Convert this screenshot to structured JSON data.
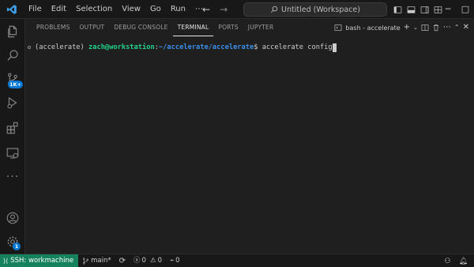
{
  "menu": [
    "File",
    "Edit",
    "Selection",
    "View",
    "Go",
    "Run"
  ],
  "command_center": {
    "text": "Untitled (Workspace)"
  },
  "activity_badges": {
    "source_control": "1K+",
    "accounts_settings": "1"
  },
  "panel": {
    "tabs": [
      "PROBLEMS",
      "OUTPUT",
      "DEBUG CONSOLE",
      "TERMINAL",
      "PORTS",
      "JUPYTER"
    ],
    "active_tab": "TERMINAL",
    "terminal_name": "bash - accelerate"
  },
  "terminal": {
    "env": "(accelerate)",
    "user_host": "zach@workstation",
    "sep": ":",
    "path": "~/accelerate/accelerate",
    "prompt": "$",
    "command": "accelerate config"
  },
  "status": {
    "remote": "SSH: workmachine",
    "branch": "main*",
    "errors": "0",
    "warnings": "0",
    "ports": "0"
  },
  "colors": {
    "accent": "#0078d4",
    "remote_bg": "#16825d",
    "prompt_user": "#23d18b",
    "prompt_path": "#3b8eea"
  }
}
